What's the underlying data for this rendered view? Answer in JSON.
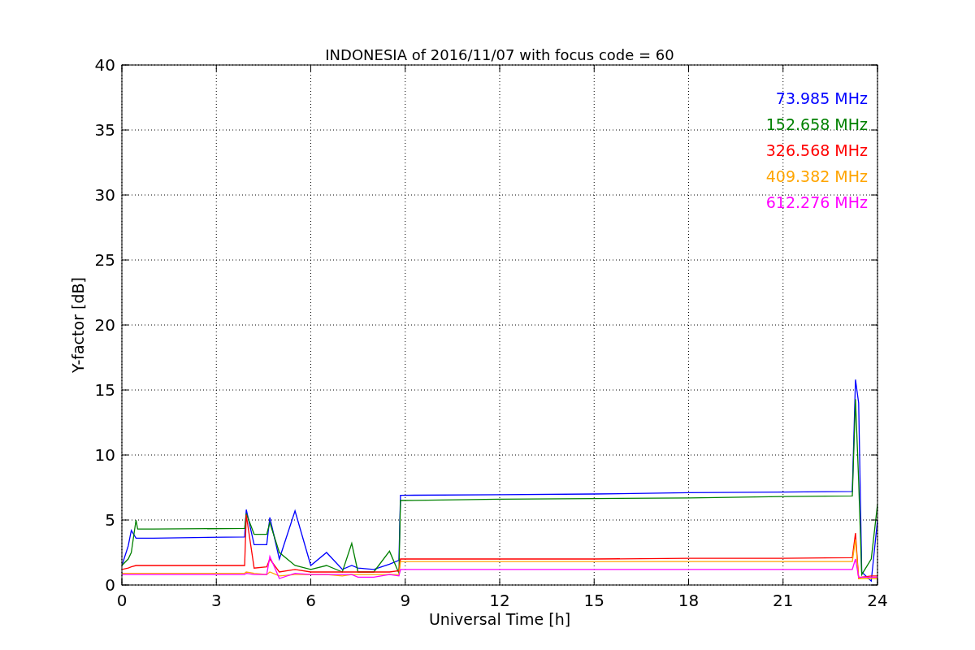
{
  "chart_data": {
    "type": "line",
    "title": "INDONESIA of 2016/11/07 with focus code = 60",
    "xlabel": "Universal Time [h]",
    "ylabel": "Y-factor [dB]",
    "x": [
      0,
      0.2,
      0.3,
      0.45,
      0.5,
      1,
      3.9,
      3.95,
      4.2,
      4.6,
      4.7,
      5,
      5.5,
      6,
      6.5,
      7,
      7.3,
      7.5,
      8,
      8.5,
      8.8,
      8.85,
      12,
      15,
      18,
      21,
      23.2,
      23.3,
      23.4,
      23.5,
      23.8,
      24
    ],
    "series": [
      {
        "name": "73.985 MHz",
        "color": "#0000ff",
        "values": [
          1.5,
          3,
          4.2,
          3.6,
          3.6,
          3.6,
          3.7,
          5.8,
          3.1,
          3.1,
          5.2,
          2.0,
          5.7,
          1.5,
          2.5,
          1.2,
          1.5,
          1.3,
          1.2,
          1.6,
          1.9,
          6.9,
          6.95,
          7.0,
          7.1,
          7.15,
          7.2,
          15.8,
          14,
          1,
          0.3,
          5
        ]
      },
      {
        "name": "152.658 MHz",
        "color": "#008000",
        "values": [
          1.5,
          2,
          2.5,
          5,
          4.3,
          4.3,
          4.35,
          5.5,
          3.9,
          3.9,
          4.8,
          2.5,
          1.5,
          1.2,
          1.5,
          1.0,
          3.2,
          1.0,
          1.0,
          2.6,
          0.9,
          6.5,
          6.6,
          6.65,
          6.7,
          6.8,
          6.85,
          14.3,
          8,
          0.8,
          2,
          6.2
        ]
      },
      {
        "name": "326.568 MHz",
        "color": "#ff0000",
        "values": [
          1.2,
          1.3,
          1.4,
          1.5,
          1.5,
          1.5,
          1.5,
          5.4,
          1.3,
          1.4,
          2,
          1.0,
          1.2,
          1.0,
          1.0,
          1.0,
          1.0,
          1.0,
          1.0,
          1.0,
          1.1,
          2.0,
          2.0,
          2.0,
          2.05,
          2.05,
          2.1,
          4,
          0.5,
          0.6,
          0.7,
          0.7
        ]
      },
      {
        "name": "409.382 MHz",
        "color": "#ffa500",
        "values": [
          0.9,
          0.9,
          0.9,
          0.9,
          0.9,
          0.9,
          0.9,
          1.0,
          0.9,
          0.8,
          1.0,
          0.7,
          0.8,
          0.8,
          0.8,
          0.7,
          0.8,
          0.8,
          0.8,
          0.8,
          0.8,
          1.8,
          1.8,
          1.8,
          1.8,
          1.8,
          1.8,
          3.5,
          0.5,
          0.5,
          0.5,
          0.5
        ]
      },
      {
        "name": "612.276 MHz",
        "color": "#ff00ff",
        "values": [
          0.8,
          0.8,
          0.8,
          0.8,
          0.8,
          0.8,
          0.8,
          0.9,
          0.8,
          0.8,
          2.2,
          0.5,
          0.9,
          0.8,
          0.8,
          0.8,
          0.8,
          0.6,
          0.6,
          0.8,
          0.7,
          1.2,
          1.2,
          1.2,
          1.2,
          1.2,
          1.2,
          2,
          0.6,
          0.6,
          0.6,
          0.6
        ]
      }
    ],
    "grid": true,
    "xlim": [
      0,
      24
    ],
    "ylim": [
      0,
      40
    ],
    "xticks": [
      0,
      3,
      6,
      9,
      12,
      15,
      18,
      21,
      24
    ],
    "yticks": [
      0,
      5,
      10,
      15,
      20,
      25,
      30,
      35,
      40
    ]
  }
}
